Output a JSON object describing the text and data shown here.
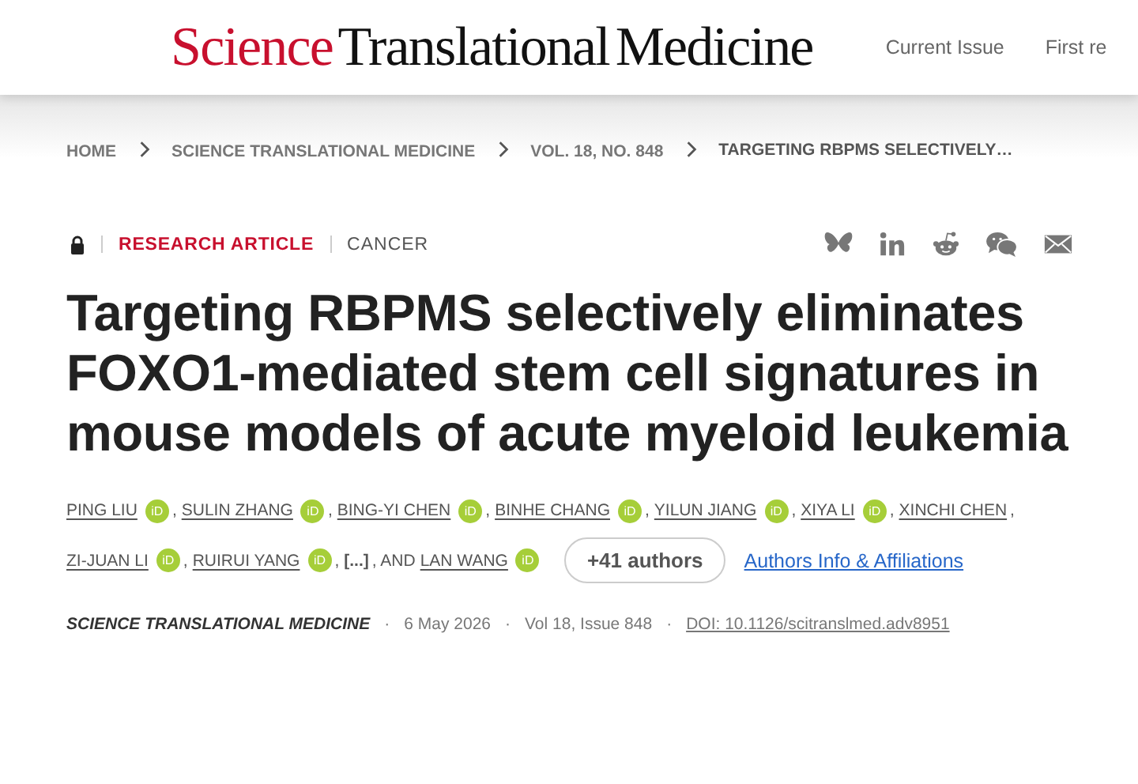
{
  "header": {
    "logo_red": "Science",
    "logo_black": "Translational Medicine",
    "nav": [
      "Current Issue",
      "First re"
    ]
  },
  "breadcrumb": [
    {
      "label": "HOME",
      "current": false
    },
    {
      "label": "SCIENCE TRANSLATIONAL MEDICINE",
      "current": false
    },
    {
      "label": "VOL. 18, NO. 848",
      "current": false
    },
    {
      "label": "TARGETING RBPMS SELECTIVELY…",
      "current": true
    }
  ],
  "article_type": "RESEARCH ARTICLE",
  "subject": "CANCER",
  "share": [
    {
      "kind": "bluesky"
    },
    {
      "kind": "linkedin"
    },
    {
      "kind": "reddit"
    },
    {
      "kind": "wechat"
    },
    {
      "kind": "email"
    }
  ],
  "title": "Targeting RBPMS selectively eliminates FOXO1-mediated stem cell signatures in mouse models of acute myeloid leukemia",
  "authors": [
    {
      "kind": "author",
      "name": "PING LIU",
      "badge": "iD",
      "after": ","
    },
    {
      "kind": "author",
      "name": "SULIN ZHANG",
      "badge": "iD",
      "after": ","
    },
    {
      "kind": "author",
      "name": "BING-YI CHEN",
      "badge": "iD",
      "after": ","
    },
    {
      "kind": "author",
      "name": "BINHE CHANG",
      "badge": "iD",
      "after": ","
    },
    {
      "kind": "author",
      "name": "YILUN JIANG",
      "badge": "iD",
      "after": ","
    },
    {
      "kind": "author",
      "name": "XIYA LI",
      "badge": "iD",
      "after": ","
    },
    {
      "kind": "author",
      "name": "XINCHI CHEN",
      "after": ","
    },
    {
      "kind": "author",
      "name": "ZI-JUAN LI",
      "badge": "iD",
      "after": ","
    },
    {
      "kind": "author",
      "name": "RUIRUI YANG",
      "badge": "iD",
      "after": ","
    },
    {
      "kind": "omitted",
      "name": "[...]",
      "after": ", AND"
    },
    {
      "kind": "author",
      "name": "LAN WANG",
      "badge": "iD"
    }
  ],
  "more_authors": "+41 authors",
  "affiliations_link": "Authors Info & Affiliations",
  "meta": [
    {
      "kind": "journal",
      "text": "SCIENCE TRANSLATIONAL MEDICINE"
    },
    {
      "kind": "separator",
      "text": "·"
    },
    {
      "kind": "date",
      "text": "6 May 2026"
    },
    {
      "kind": "separator",
      "text": "·"
    },
    {
      "kind": "issue",
      "text": "Vol 18, Issue 848"
    },
    {
      "kind": "separator",
      "text": "·"
    },
    {
      "kind": "doi",
      "text": "DOI: 10.1126/scitranslmed.adv8951"
    }
  ]
}
